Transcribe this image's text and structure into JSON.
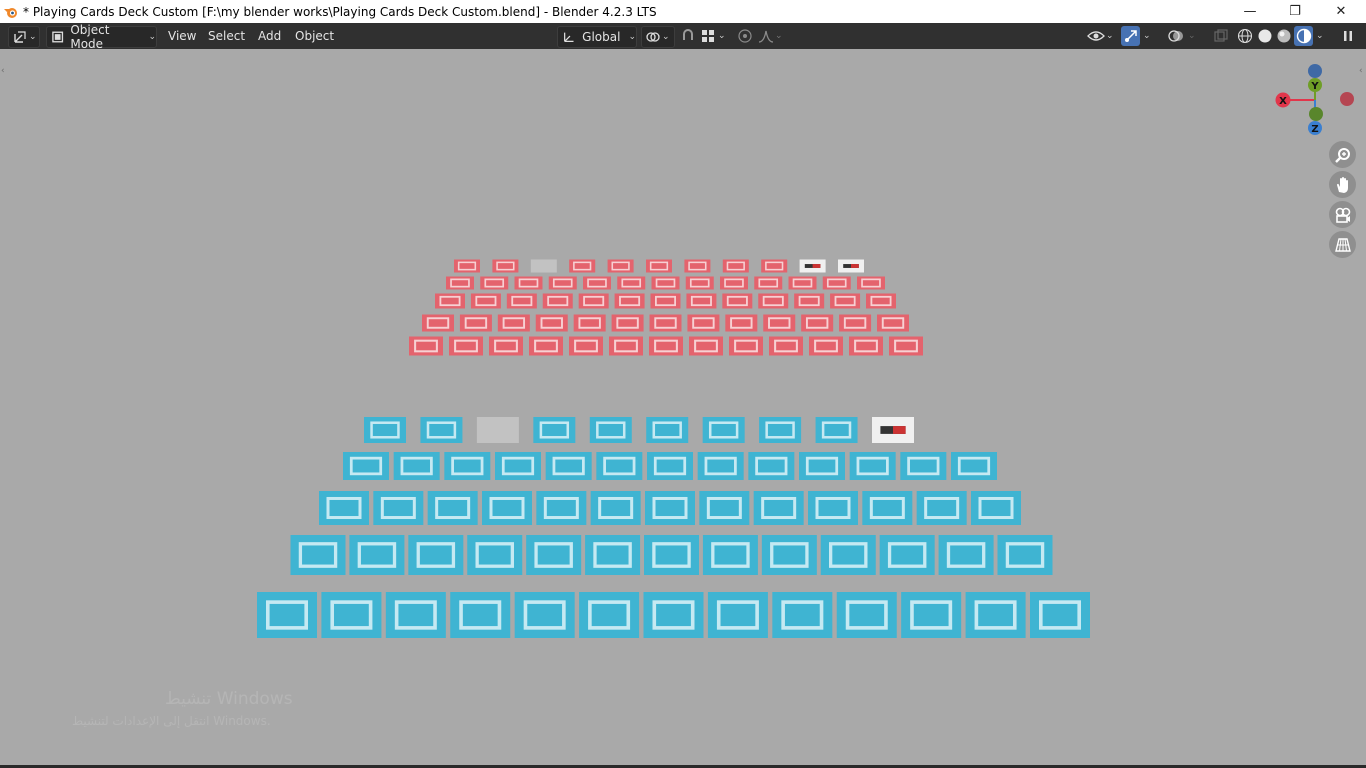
{
  "window": {
    "title": "* Playing Cards Deck Custom [F:\\my blender works\\Playing Cards Deck Custom.blend] - Blender 4.2.3 LTS",
    "controls": {
      "minimize": "—",
      "restore": "❐",
      "close": "✕"
    }
  },
  "header": {
    "editor_type_icon": "viewport-editor-icon",
    "mode_label": "Object Mode",
    "menus": [
      "View",
      "Select",
      "Add",
      "Object"
    ],
    "orientation_label": "Global",
    "icons": [
      "pivot-icon",
      "snap-icon",
      "snap-increment-icon",
      "proportional-edit-icon",
      "falloff-icon",
      "visibility-icon",
      "gizmo-icon",
      "overlay-icon",
      "xray-icon",
      "wireframe-shading-icon",
      "solid-shading-icon",
      "material-shading-icon",
      "rendered-shading-icon",
      "sidebar-toggle-icon"
    ]
  },
  "gizmo": {
    "x_label": "X",
    "y_label": "Y",
    "z_label": "Z",
    "colors": {
      "x": "#e2364b",
      "y": "#6f9e26",
      "z": "#3a7fd0"
    }
  },
  "nav_buttons": [
    "zoom-icon",
    "pan-hand-icon",
    "camera-view-icon",
    "perspective-grid-icon"
  ],
  "scene": {
    "red_deck_color": "#e4636d",
    "blue_deck_color": "#3fb4d2",
    "face_card_color": "#f0f0f0"
  },
  "watermark": {
    "line1": "تنشيط Windows",
    "line2": "انتقل إلى الإعدادات لتنشيط Windows."
  }
}
